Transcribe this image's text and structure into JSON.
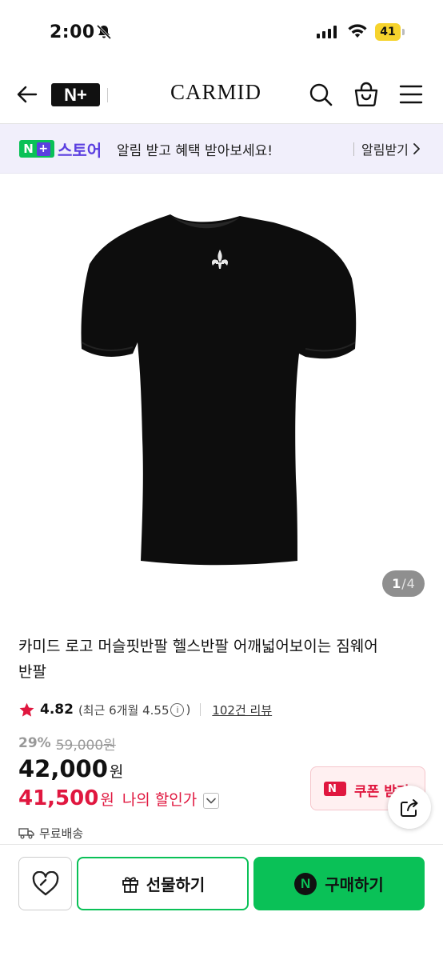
{
  "status_bar": {
    "time": "2:00",
    "battery": "41"
  },
  "header": {
    "brand_logo": "N+",
    "brand_title": "CARMID",
    "icons": [
      "back-icon",
      "search-icon",
      "bag-icon",
      "menu-icon"
    ]
  },
  "store_banner": {
    "logo_n": "N",
    "logo_plus": "+",
    "store_name": "스토어",
    "message": "알림 받고 혜택 받아보세요!",
    "alarm_button": "알림받기"
  },
  "gallery": {
    "current_page": "1",
    "separator": "/",
    "total_pages": "4"
  },
  "product": {
    "title": "카미드 로고 머슬핏반팔 헬스반팔 어깨넓어보이는 짐웨어반팔",
    "rating": "4.82",
    "recent_rating": "(최근 6개월 4.55",
    "recent_rating_close": ")",
    "info_symbol": "i",
    "review_count": "102건 리뷰",
    "discount_rate": "29%",
    "original_price": "59,000원",
    "sale_price": "42,000",
    "sale_price_unit": "원",
    "my_price": "41,500",
    "my_price_unit": "원",
    "my_price_label": "나의 할인가",
    "coupon_label": "쿠폰 받기",
    "coupon_badge": "N",
    "shipping": "무료배송"
  },
  "bottom_bar": {
    "gift_label": "선물하기",
    "buy_label": "구매하기",
    "npay_symbol": "N"
  },
  "colors": {
    "naver_green": "#0ac157",
    "store_purple": "#5b3fe0",
    "price_red": "#e0173f",
    "battery_yellow": "#f6d32d"
  }
}
